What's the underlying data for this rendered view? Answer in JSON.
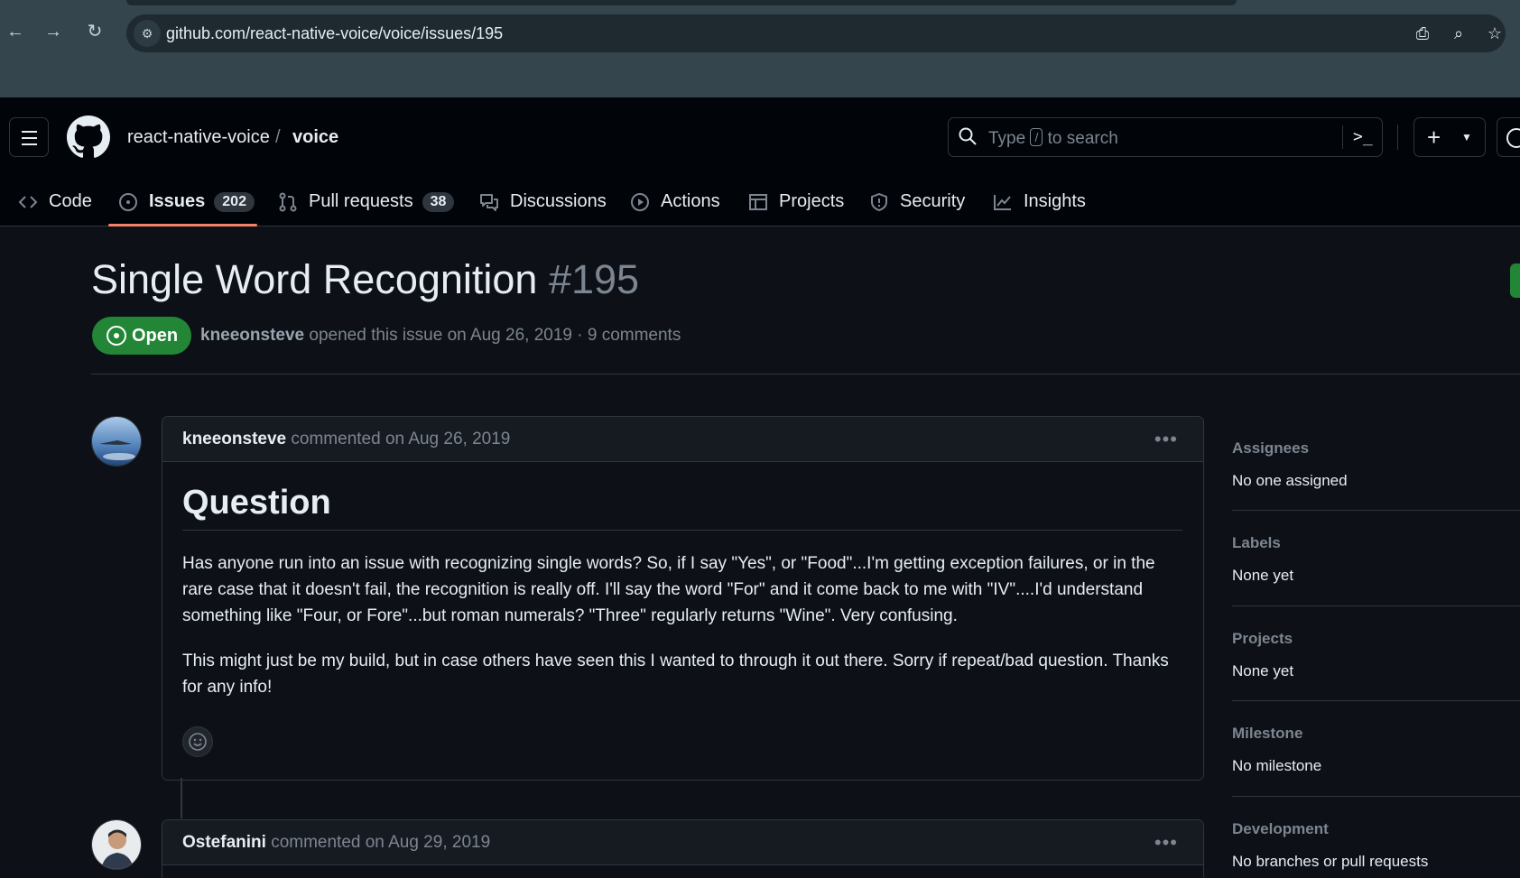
{
  "browser": {
    "url": "github.com/react-native-voice/voice/issues/195"
  },
  "header": {
    "owner": "react-native-voice",
    "separator": "/",
    "repo": "voice",
    "search_prefix": "Type",
    "search_key": "/",
    "search_suffix": "to search",
    "create_plus": "+"
  },
  "nav": {
    "code": "Code",
    "issues": "Issues",
    "issues_count": "202",
    "pulls": "Pull requests",
    "pulls_count": "38",
    "discussions": "Discussions",
    "actions": "Actions",
    "projects": "Projects",
    "security": "Security",
    "insights": "Insights"
  },
  "issue": {
    "title": "Single Word Recognition",
    "number": "#195",
    "state": "Open",
    "author": "kneeonsteve",
    "meta": "opened this issue on Aug 26, 2019 · 9 comments"
  },
  "comments": [
    {
      "author": "kneeonsteve",
      "date": "commented on Aug 26, 2019",
      "heading": "Question",
      "para1": "Has anyone run into an issue with recognizing single words? So, if I say \"Yes\", or \"Food\"...I'm getting exception failures, or in the rare case that it doesn't fail, the recognition is really off. I'll say the word \"For\" and it come back to me with \"IV\"....I'd understand something like \"Four, or Fore\"...but roman numerals? \"Three\" regularly returns \"Wine\". Very confusing.",
      "para2": "This might just be my build, but in case others have seen this I wanted to through it out there. Sorry if repeat/bad question. Thanks for any info!"
    },
    {
      "author": "Ostefanini",
      "date": "commented on Aug 29, 2019"
    }
  ],
  "sidebar": {
    "assignees_title": "Assignees",
    "assignees_value": "No one assigned",
    "labels_title": "Labels",
    "labels_value": "None yet",
    "projects_title": "Projects",
    "projects_value": "None yet",
    "milestone_title": "Milestone",
    "milestone_value": "No milestone",
    "development_title": "Development",
    "development_value": "No branches or pull requests"
  },
  "colors": {
    "background": "#0d1117",
    "header": "#010409",
    "open_green": "#238636",
    "tab_underline": "#f78166",
    "muted": "#7d8590"
  }
}
